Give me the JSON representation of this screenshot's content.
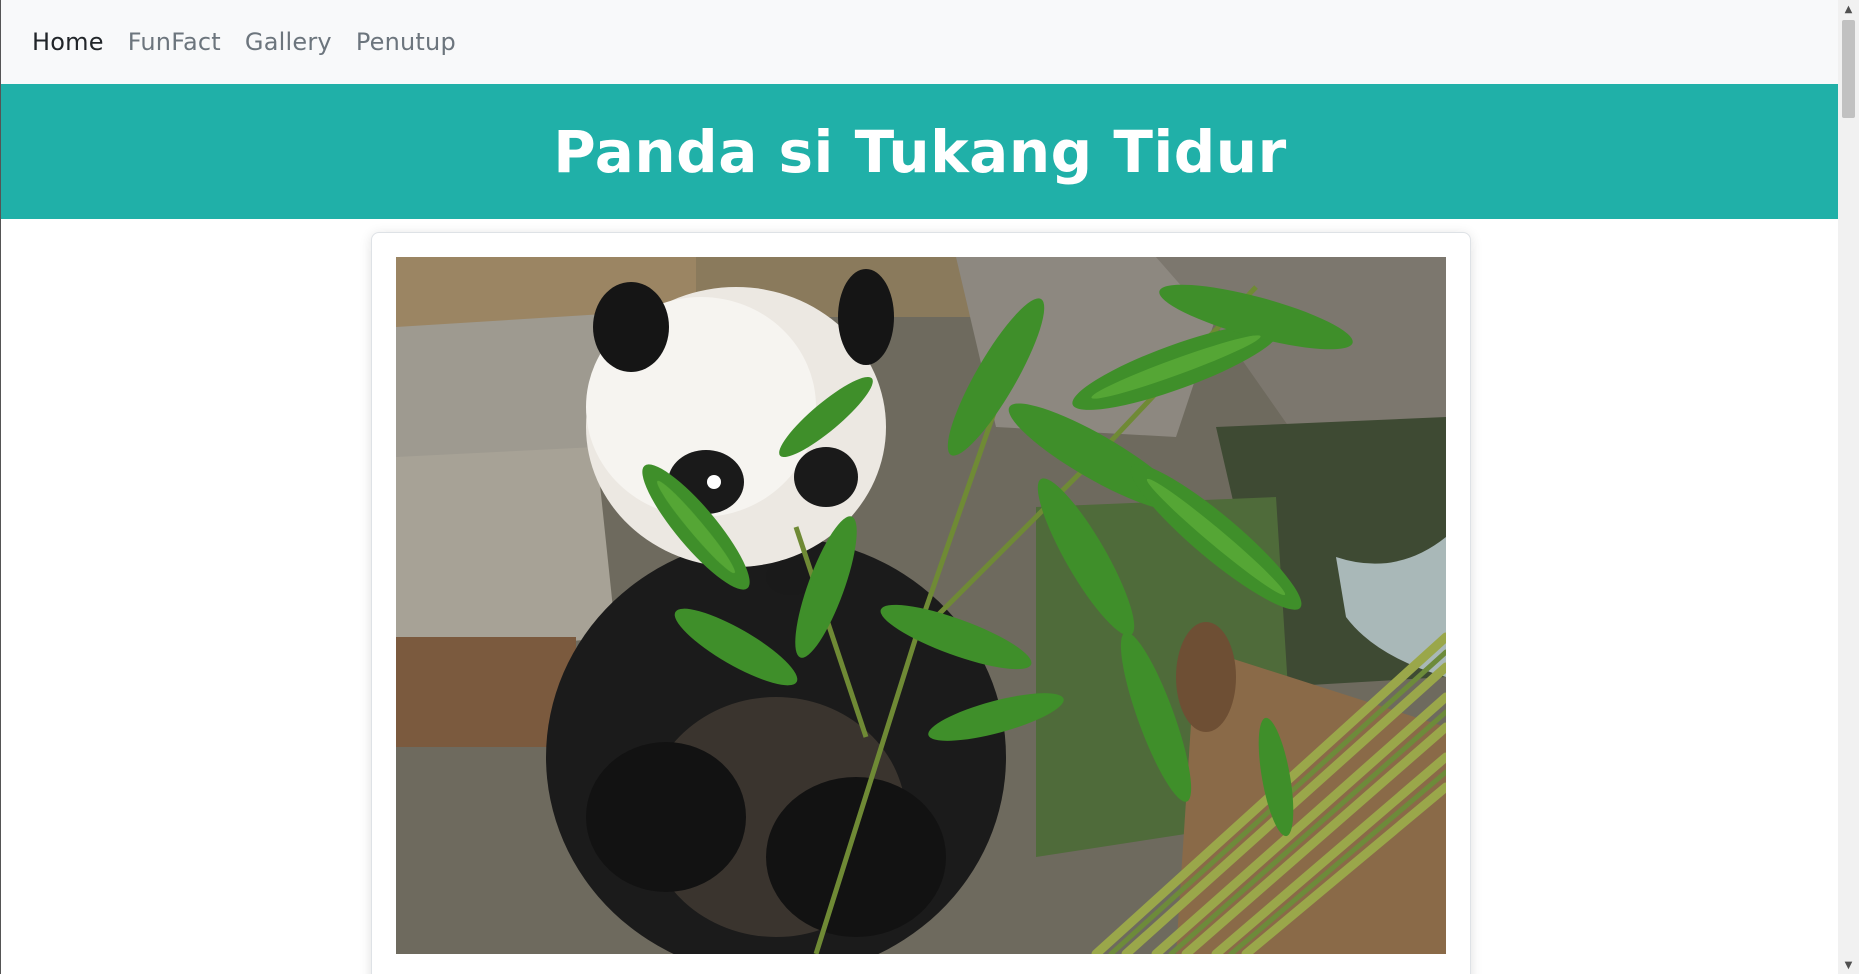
{
  "nav": {
    "items": [
      {
        "label": "Home",
        "active": true
      },
      {
        "label": "FunFact",
        "active": false
      },
      {
        "label": "Gallery",
        "active": false
      },
      {
        "label": "Penutup",
        "active": false
      }
    ]
  },
  "banner": {
    "title": "Panda si Tukang Tidur",
    "color": "#20b0a8"
  },
  "hero_image": {
    "icon": "panda-eating-bamboo-photo"
  },
  "scrollbar": {
    "up_arrow": "▲",
    "down_arrow": "▼",
    "position": 0.0
  }
}
